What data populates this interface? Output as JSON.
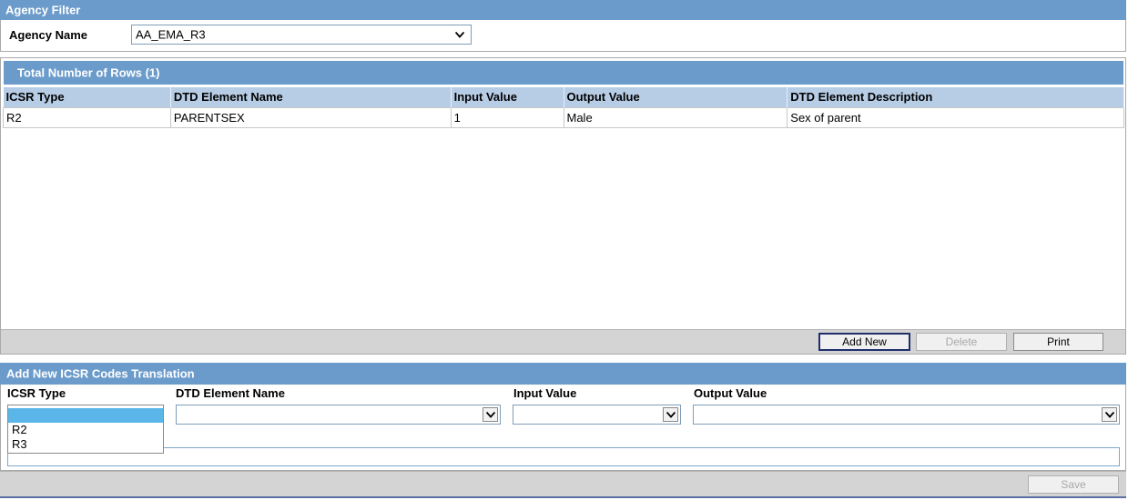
{
  "agency_filter": {
    "title": "Agency Filter",
    "agency_name_label": "Agency Name",
    "agency_name_value": "AA_EMA_R3"
  },
  "results": {
    "title": "Total Number of Rows (1)",
    "columns": [
      "ICSR Type",
      "DTD Element Name",
      "Input Value",
      "Output Value",
      "DTD Element Description"
    ],
    "rows": [
      [
        "R2",
        "PARENTSEX",
        "1",
        "Male",
        "Sex of parent"
      ]
    ],
    "buttons": {
      "add_new": "Add New",
      "delete": "Delete",
      "print": "Print"
    }
  },
  "add_new": {
    "title": "Add New ICSR Codes Translation",
    "labels": {
      "icsr_type": "ICSR Type",
      "dtd_element_name": "DTD Element Name",
      "input_value": "Input Value",
      "output_value": "Output Value"
    },
    "icsr_type_options": [
      "",
      "R2",
      "R3"
    ],
    "save": "Save"
  },
  "icons": {
    "dropdown": "chevron-down-icon"
  }
}
